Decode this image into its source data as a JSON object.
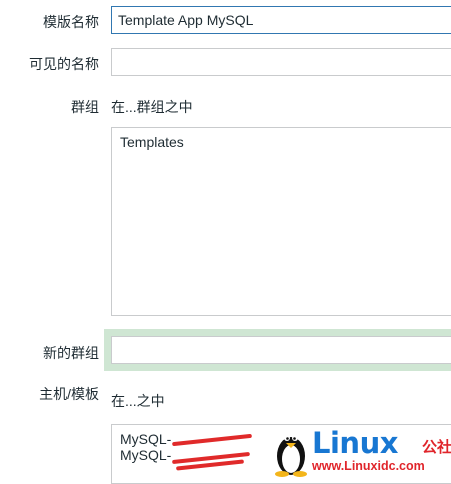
{
  "form": {
    "template_name": {
      "label": "模版名称",
      "value": "Template App MySQL"
    },
    "visible_name": {
      "label": "可见的名称",
      "value": ""
    },
    "groups": {
      "label": "群组",
      "hint": "在...群组之中",
      "items": [
        "Templates"
      ]
    },
    "new_group": {
      "label": "新的群组",
      "value": ""
    },
    "hosts_templates": {
      "label": "主机/模板",
      "hint": "在...之中",
      "items": [
        "MySQL-",
        "MySQL-"
      ]
    }
  },
  "watermark": {
    "brand": "Linux",
    "cn": "公社",
    "url": "www.Linuxidc.com"
  },
  "colors": {
    "focus_border": "#3177b1",
    "focus_glow": "#cfe6d3",
    "redaction": "#e02a2a",
    "brand_blue": "#1877d2",
    "brand_red": "#e0252b"
  }
}
